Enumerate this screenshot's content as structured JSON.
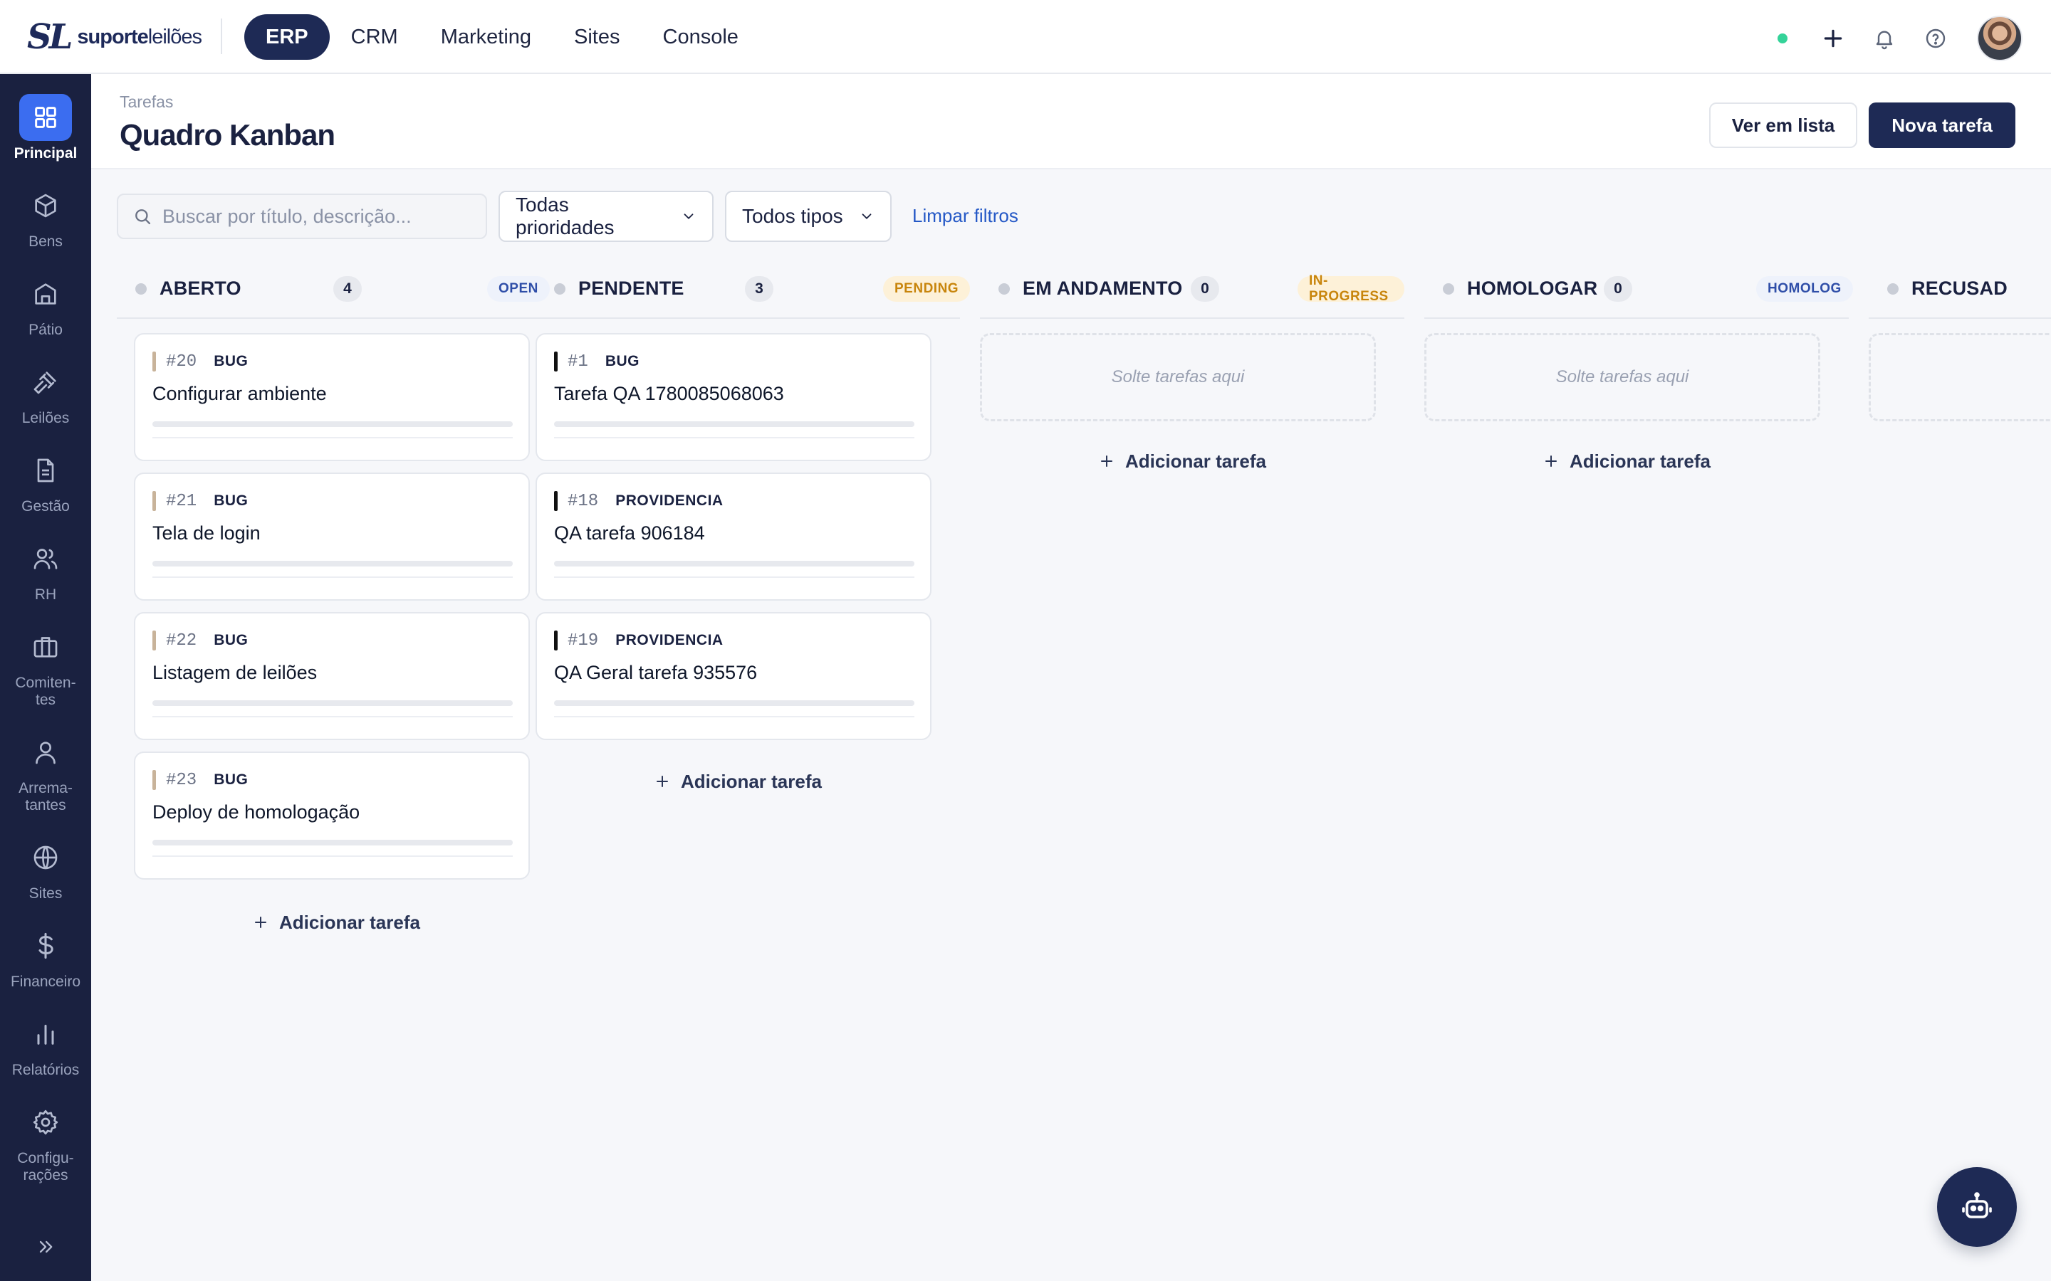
{
  "brand": {
    "mark": "SL",
    "name_bold": "suporte",
    "name_light": "leilões"
  },
  "topnav": [
    {
      "label": "ERP",
      "active": true
    },
    {
      "label": "CRM",
      "active": false
    },
    {
      "label": "Marketing",
      "active": false
    },
    {
      "label": "Sites",
      "active": false
    },
    {
      "label": "Console",
      "active": false
    }
  ],
  "sidebar": {
    "items": [
      {
        "label": "Principal",
        "icon": "grid-icon",
        "active": true
      },
      {
        "label": "Bens",
        "icon": "box-icon"
      },
      {
        "label": "Pátio",
        "icon": "building-icon"
      },
      {
        "label": "Leilões",
        "icon": "gavel-icon"
      },
      {
        "label": "Gestão",
        "icon": "document-icon"
      },
      {
        "label": "RH",
        "icon": "people-icon"
      },
      {
        "label": "Comiten-tes",
        "line1": "Comiten-",
        "line2": "tes",
        "icon": "briefcase-icon"
      },
      {
        "label": "Arrema-tantes",
        "line1": "Arrema-",
        "line2": "tantes",
        "icon": "person-icon"
      },
      {
        "label": "Sites",
        "icon": "globe-icon"
      },
      {
        "label": "Financeiro",
        "icon": "dollar-icon"
      },
      {
        "label": "Relatórios",
        "icon": "bar-chart-icon"
      },
      {
        "label": "Configu-rações",
        "line1": "Configu-",
        "line2": "rações",
        "icon": "gear-icon"
      }
    ]
  },
  "header": {
    "breadcrumb": "Tarefas",
    "title": "Quadro Kanban",
    "list_button": "Ver em lista",
    "new_button": "Nova tarefa"
  },
  "filters": {
    "search_placeholder": "Buscar por título, descrição...",
    "search_value": "",
    "priority": "Todas prioridades",
    "type": "Todos tipos",
    "clear": "Limpar filtros"
  },
  "columns": [
    {
      "title": "ABERTO",
      "count": "4",
      "badge": "OPEN",
      "cards": [
        {
          "id": "#20",
          "type": "BUG",
          "title": "Configurar ambiente",
          "bar_color": "#c8b39a"
        },
        {
          "id": "#21",
          "type": "BUG",
          "title": "Tela de login",
          "bar_color": "#c8b39a"
        },
        {
          "id": "#22",
          "type": "BUG",
          "title": "Listagem de leilões",
          "bar_color": "#c8b39a"
        },
        {
          "id": "#23",
          "type": "BUG",
          "title": "Deploy de homologação",
          "bar_color": "#c8b39a"
        }
      ],
      "add_label": "Adicionar tarefa"
    },
    {
      "title": "PENDENTE",
      "count": "3",
      "badge": "PENDING",
      "cards": [
        {
          "id": "#1",
          "type": "BUG",
          "title": "Tarefa QA 1780085068063",
          "bar_color": "#111111"
        },
        {
          "id": "#18",
          "type": "PROVIDENCIA",
          "title": "QA tarefa 906184",
          "bar_color": "#111111"
        },
        {
          "id": "#19",
          "type": "PROVIDENCIA",
          "title": "QA Geral tarefa 935576",
          "bar_color": "#111111"
        }
      ],
      "add_label": "Adicionar tarefa"
    },
    {
      "title": "EM ANDAMENTO",
      "count": "0",
      "badge": "IN-PROGRESS",
      "dropzone": "Solte tarefas aqui",
      "add_label": "Adicionar tarefa"
    },
    {
      "title": "HOMOLOGAR",
      "count": "0",
      "badge": "HOMOLOG",
      "dropzone": "Solte tarefas aqui",
      "add_label": "Adicionar tarefa"
    },
    {
      "title": "RECUSAD"
    }
  ],
  "colors": {
    "brand_navy": "#1e2a55",
    "sidebar_bg": "#1a2140",
    "sidebar_active": "#3b6df0",
    "status_online": "#34d399",
    "link_blue": "#2458c6"
  }
}
